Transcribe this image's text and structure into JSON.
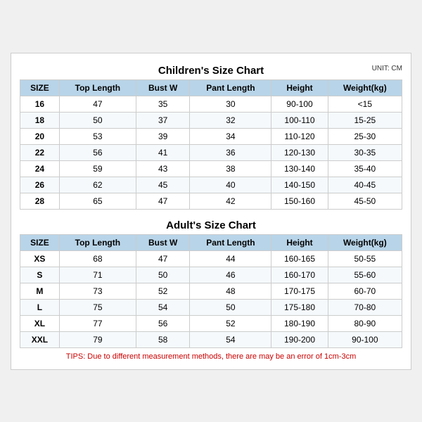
{
  "children_title": "Children's Size Chart",
  "adult_title": "Adult's Size Chart",
  "unit_label": "UNIT: CM",
  "headers": [
    "SIZE",
    "Top Length",
    "Bust W",
    "Pant Length",
    "Height",
    "Weight(kg)"
  ],
  "children_rows": [
    [
      "16",
      "47",
      "35",
      "30",
      "90-100",
      "<15"
    ],
    [
      "18",
      "50",
      "37",
      "32",
      "100-110",
      "15-25"
    ],
    [
      "20",
      "53",
      "39",
      "34",
      "110-120",
      "25-30"
    ],
    [
      "22",
      "56",
      "41",
      "36",
      "120-130",
      "30-35"
    ],
    [
      "24",
      "59",
      "43",
      "38",
      "130-140",
      "35-40"
    ],
    [
      "26",
      "62",
      "45",
      "40",
      "140-150",
      "40-45"
    ],
    [
      "28",
      "65",
      "47",
      "42",
      "150-160",
      "45-50"
    ]
  ],
  "adult_rows": [
    [
      "XS",
      "68",
      "47",
      "44",
      "160-165",
      "50-55"
    ],
    [
      "S",
      "71",
      "50",
      "46",
      "160-170",
      "55-60"
    ],
    [
      "M",
      "73",
      "52",
      "48",
      "170-175",
      "60-70"
    ],
    [
      "L",
      "75",
      "54",
      "50",
      "175-180",
      "70-80"
    ],
    [
      "XL",
      "77",
      "56",
      "52",
      "180-190",
      "80-90"
    ],
    [
      "XXL",
      "79",
      "58",
      "54",
      "190-200",
      "90-100"
    ]
  ],
  "tips": "TIPS: Due to different measurement methods, there are may be an error of 1cm-3cm"
}
